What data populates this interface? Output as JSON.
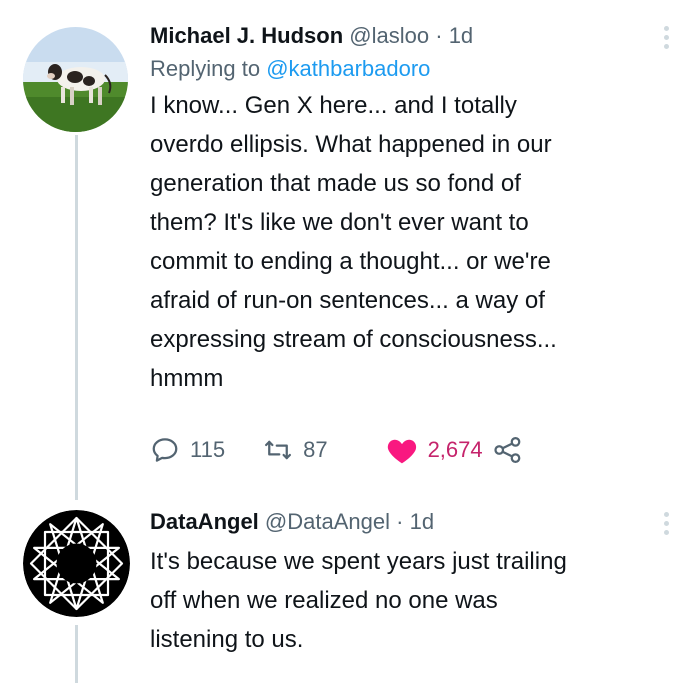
{
  "tweets": [
    {
      "name": "Michael J. Hudson",
      "handle": "@lasloo",
      "separator": "·",
      "time": "1d",
      "replying_prefix": "Replying to",
      "replying_to": "@kathbarbadoro",
      "text": "I know... Gen X here... and I totally\noverdo ellipsis.  What happened in our\ngeneration that made us so fond of\nthem?  It's like we don't ever want to\ncommit to ending a thought... or we're\nafraid of run-on sentences... a way of\nexpressing stream of consciousness...\nhmmm",
      "actions": {
        "reply_count": "115",
        "retweet_count": "87",
        "like_count": "2,674"
      },
      "avatar_icon": "cow-in-field-avatar"
    },
    {
      "name": "DataAngel",
      "handle": "@DataAngel",
      "separator": "·",
      "time": "1d",
      "text": "It's because we spent years just trailing\noff when we realized no one was\nlistening to us.",
      "avatar_icon": "star-polygon-avatar"
    }
  ],
  "icons": {
    "reply": "speech-bubble-icon",
    "retweet": "retweet-icon",
    "like": "heart-icon",
    "share": "share-icon",
    "more": "more-options-icon"
  },
  "colors": {
    "like_active": "#f91880",
    "link": "#1d9bf0",
    "secondary_text": "#536471",
    "thread_line": "#cfd9de"
  }
}
